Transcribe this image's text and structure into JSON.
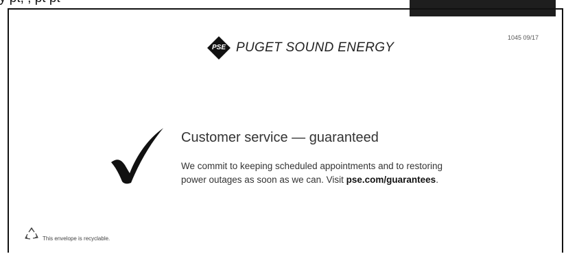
{
  "top_strip_text": "y                                            pt, ,    pt    pt",
  "logo": {
    "mark": "PSE",
    "name": "PUGET SOUND ENERGY"
  },
  "form_code": "1045 09/17",
  "check_icon": "checkmark-icon",
  "heading": "Customer service — guaranteed",
  "body": {
    "line1": "We commit to keeping scheduled appointments and to restoring",
    "line2_prefix": "power outages as soon as we can. Visit ",
    "link": "pse.com/guarantees",
    "line2_suffix": "."
  },
  "recycle": {
    "icon": "recycle-icon",
    "text": "This envelope is recyclable."
  },
  "colors": {
    "ink": "#111111",
    "text": "#333333",
    "background": "#ffffff"
  }
}
